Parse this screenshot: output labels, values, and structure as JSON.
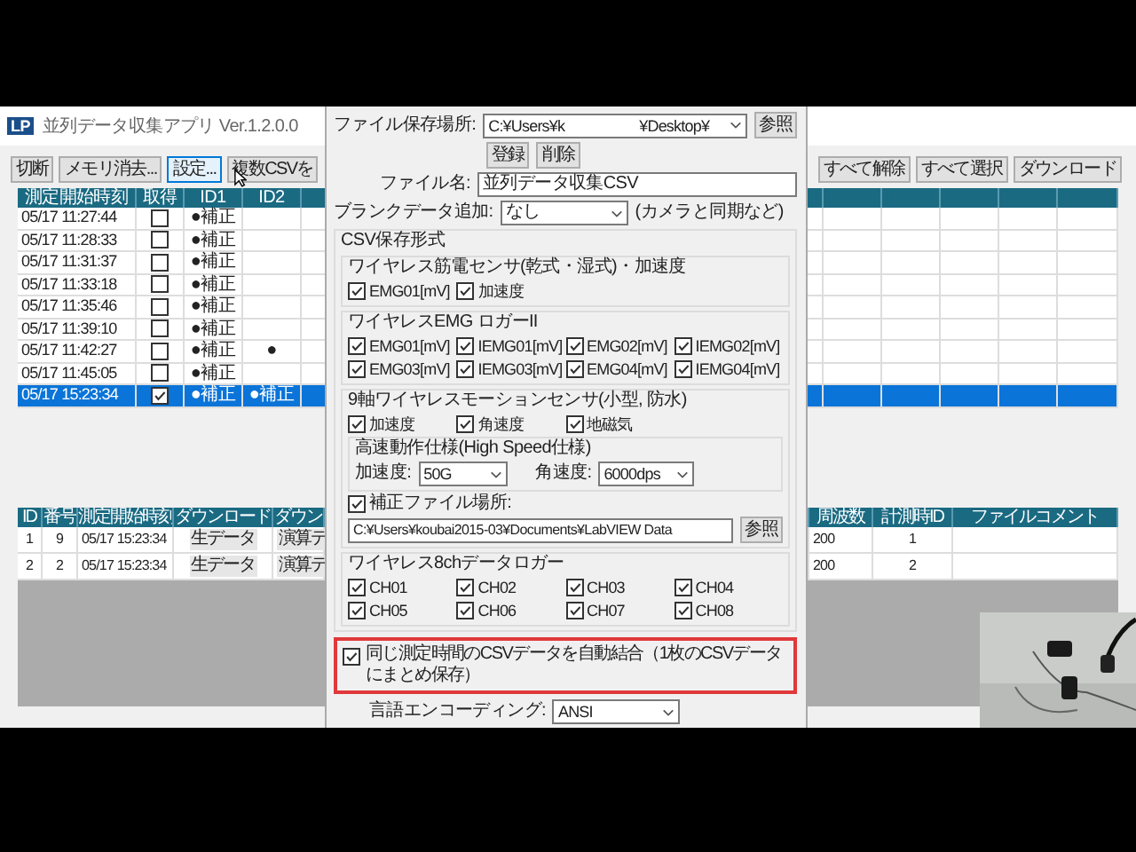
{
  "window": {
    "icon_label": "LP",
    "title": "並列データ収集アプリ Ver.1.2.0.0"
  },
  "toolbar": {
    "left": [
      {
        "label": "切断",
        "hovered": false
      },
      {
        "label": "メモリ消去...",
        "hovered": false
      },
      {
        "label": "設定...",
        "hovered": true
      },
      {
        "label": "複数CSVを",
        "hovered": false
      }
    ],
    "right": [
      {
        "label": "すべて解除",
        "hovered": false
      },
      {
        "label": "すべて選択",
        "hovered": false
      },
      {
        "label": "ダウンロード",
        "hovered": false
      }
    ]
  },
  "runs_table": {
    "columns": [
      "測定開始時刻",
      "取得",
      "ID1",
      "ID2"
    ],
    "rows": [
      {
        "time": "05/17 11:27:44",
        "acquired": false,
        "id1": "●補正",
        "id2": "",
        "selected": false
      },
      {
        "time": "05/17 11:28:33",
        "acquired": false,
        "id1": "●補正",
        "id2": "",
        "selected": false
      },
      {
        "time": "05/17 11:31:37",
        "acquired": false,
        "id1": "●補正",
        "id2": "",
        "selected": false
      },
      {
        "time": "05/17 11:33:18",
        "acquired": false,
        "id1": "●補正",
        "id2": "",
        "selected": false
      },
      {
        "time": "05/17 11:35:46",
        "acquired": false,
        "id1": "●補正",
        "id2": "",
        "selected": false
      },
      {
        "time": "05/17 11:39:10",
        "acquired": false,
        "id1": "●補正",
        "id2": "",
        "selected": false
      },
      {
        "time": "05/17 11:42:27",
        "acquired": false,
        "id1": "●補正",
        "id2": "●",
        "selected": false
      },
      {
        "time": "05/17 11:45:05",
        "acquired": false,
        "id1": "●補正",
        "id2": "",
        "selected": false
      },
      {
        "time": "05/17 15:23:34",
        "acquired": true,
        "id1": "●補正",
        "id2": "●補正",
        "selected": true
      }
    ]
  },
  "downloads_table": {
    "columns": [
      "ID",
      "番号",
      "測定開始時刻",
      "ダウンロード",
      "ダウン",
      "周波数",
      "計測時ID",
      "ファイルコメント"
    ],
    "rows": [
      {
        "id": "1",
        "number": "9",
        "time": "05/17 15:23:34",
        "raw": "生データ",
        "calc": "演算デ",
        "rate": "200",
        "measure_id": "1"
      },
      {
        "id": "2",
        "number": "2",
        "time": "05/17 15:23:34",
        "raw": "生データ",
        "calc": "演算デ",
        "rate": "200",
        "measure_id": "2"
      }
    ]
  },
  "dialog": {
    "save_location": {
      "label": "ファイル保存場所:",
      "value": "C:¥Users¥k                    ¥Desktop¥",
      "browse": "参照"
    },
    "path_buttons": [
      "登録",
      "削除"
    ],
    "file_name": {
      "label": "ファイル名:",
      "value": "並列データ収集CSV"
    },
    "blank_data": {
      "label": "ブランクデータ追加:",
      "value": "なし",
      "note": "(カメラと同期など)"
    },
    "csv_format": {
      "title": "CSV保存形式",
      "groups": [
        {
          "title": "ワイヤレス筋電センサ(乾式・湿式)・加速度",
          "checks": [
            {
              "label": "EMG01[mV]",
              "checked": true
            },
            {
              "label": "加速度",
              "checked": true
            }
          ]
        },
        {
          "title": "ワイヤレスEMG ロガーII",
          "checks": [
            {
              "label": "EMG01[mV]",
              "checked": true
            },
            {
              "label": "IEMG01[mV]",
              "checked": true
            },
            {
              "label": "EMG02[mV]",
              "checked": true
            },
            {
              "label": "IEMG02[mV]",
              "checked": true
            },
            {
              "label": "EMG03[mV]",
              "checked": true
            },
            {
              "label": "IEMG03[mV]",
              "checked": true
            },
            {
              "label": "EMG04[mV]",
              "checked": true
            },
            {
              "label": "IEMG04[mV]",
              "checked": true
            }
          ]
        },
        {
          "title": "9軸ワイヤレスモーションセンサ(小型, 防水)",
          "checks": [
            {
              "label": "加速度",
              "checked": true
            },
            {
              "label": "角速度",
              "checked": true
            },
            {
              "label": "地磁気",
              "checked": true
            }
          ],
          "high_speed": {
            "title": "高速動作仕様(High Speed仕様)",
            "accel": {
              "label": "加速度:",
              "value": "50G"
            },
            "gyro": {
              "label": "角速度:",
              "value": "6000dps"
            }
          },
          "calibration": {
            "label": "補正ファイル場所:",
            "checked": true,
            "path": "C:¥Users¥koubai2015-03¥Documents¥LabVIEW Data",
            "browse": "参照"
          }
        },
        {
          "title": "ワイヤレス8chデータロガー",
          "checks": [
            {
              "label": "CH01",
              "checked": true
            },
            {
              "label": "CH02",
              "checked": true
            },
            {
              "label": "CH03",
              "checked": true
            },
            {
              "label": "CH04",
              "checked": true
            },
            {
              "label": "CH05",
              "checked": true
            },
            {
              "label": "CH06",
              "checked": true
            },
            {
              "label": "CH07",
              "checked": true
            },
            {
              "label": "CH08",
              "checked": true
            }
          ]
        }
      ]
    },
    "auto_merge": {
      "label": "同じ測定時間のCSVデータを自動結合（1枚のCSVデータにまとめ保存）",
      "checked": true,
      "highlighted": true
    },
    "encoding": {
      "label": "言語エンコーディング:",
      "value": "ANSI"
    }
  }
}
